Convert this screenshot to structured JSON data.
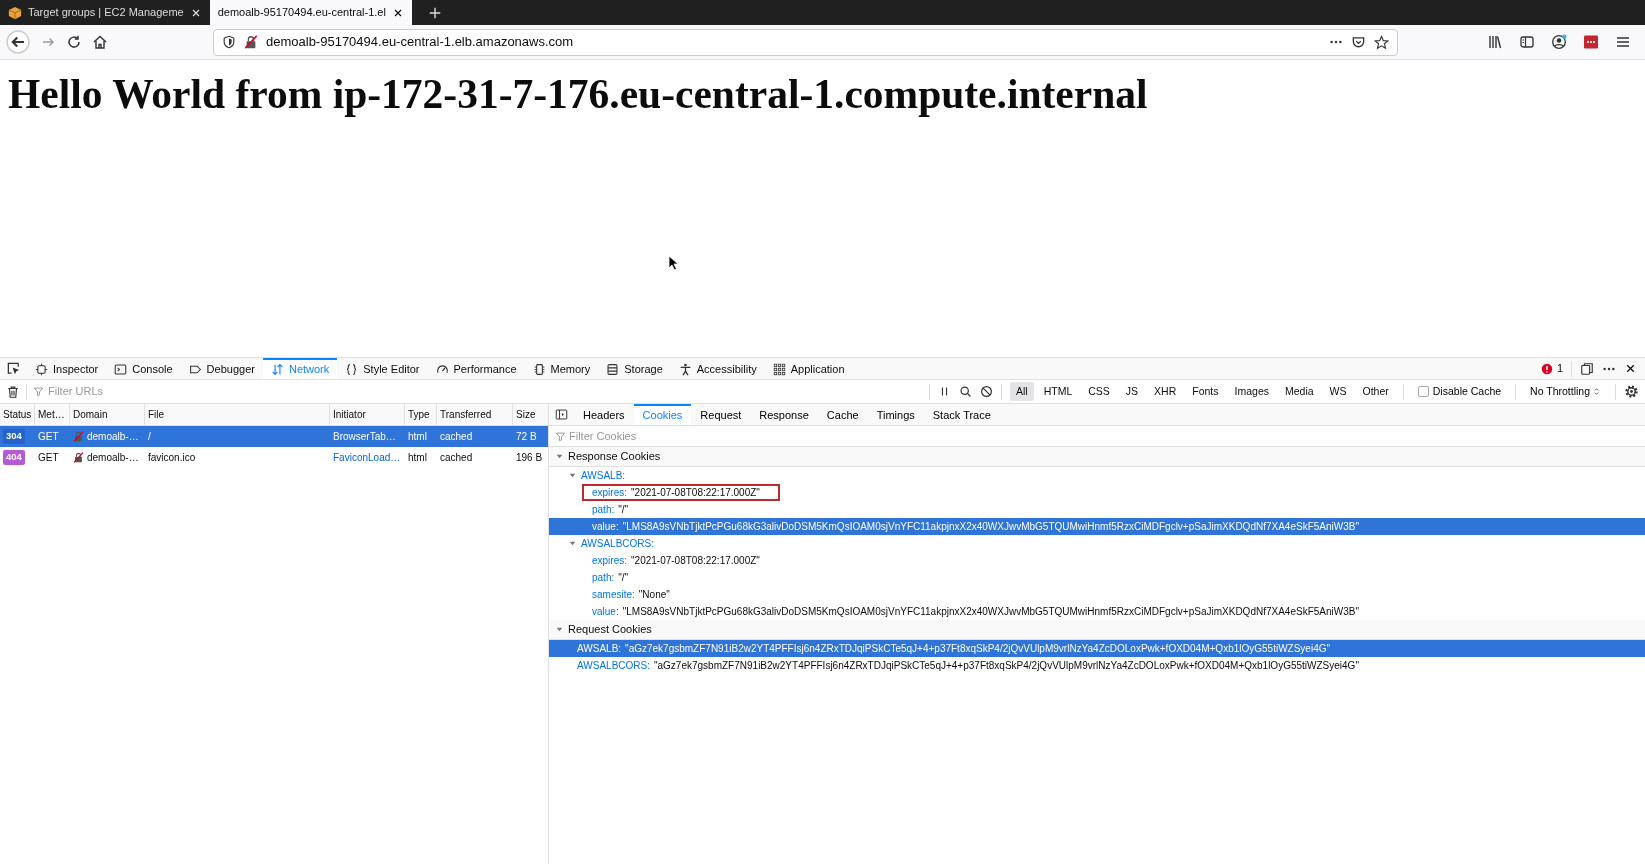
{
  "browser_tabs": [
    {
      "title": "Target groups | EC2 Manageme",
      "selected": false
    },
    {
      "title": "demoalb-95170494.eu-central-1.el",
      "selected": true
    }
  ],
  "address_bar": {
    "url": "demoalb-95170494.eu-central-1.elb.amazonaws.com"
  },
  "page": {
    "heading": "Hello World from ip-172-31-7-176.eu-central-1.compute.internal"
  },
  "devtools": {
    "tools": [
      {
        "label": "Inspector",
        "selected": false
      },
      {
        "label": "Console",
        "selected": false
      },
      {
        "label": "Debugger",
        "selected": false
      },
      {
        "label": "Network",
        "selected": true
      },
      {
        "label": "Style Editor",
        "selected": false
      },
      {
        "label": "Performance",
        "selected": false
      },
      {
        "label": "Memory",
        "selected": false
      },
      {
        "label": "Storage",
        "selected": false
      },
      {
        "label": "Accessibility",
        "selected": false
      },
      {
        "label": "Application",
        "selected": false
      }
    ],
    "error_count": "1",
    "filter_placeholder": "Filter URLs",
    "type_filters": [
      {
        "label": "All",
        "selected": true
      },
      {
        "label": "HTML",
        "selected": false
      },
      {
        "label": "CSS",
        "selected": false
      },
      {
        "label": "JS",
        "selected": false
      },
      {
        "label": "XHR",
        "selected": false
      },
      {
        "label": "Fonts",
        "selected": false
      },
      {
        "label": "Images",
        "selected": false
      },
      {
        "label": "Media",
        "selected": false
      },
      {
        "label": "WS",
        "selected": false
      },
      {
        "label": "Other",
        "selected": false
      }
    ],
    "disable_cache": {
      "label": "Disable Cache",
      "checked": false
    },
    "throttling": "No Throttling",
    "columns": [
      "Status",
      "Met…",
      "Domain",
      "File",
      "Initiator",
      "Type",
      "Transferred",
      "Size"
    ],
    "requests": [
      {
        "status": "304",
        "color": "#2563c9",
        "method": "GET",
        "domain": "demoalb-…",
        "file": "/",
        "initiator": "BrowserTab…",
        "type": "html",
        "transferred": "cached",
        "size": "72 B",
        "selected": true
      },
      {
        "status": "404",
        "color": "#b65ad6",
        "method": "GET",
        "domain": "demoalb-…",
        "file": "favicon.ico",
        "initiator": "FaviconLoad…",
        "type": "html",
        "transferred": "cached",
        "size": "196 B",
        "selected": false
      }
    ],
    "detail_tabs": [
      {
        "label": "Headers",
        "selected": false
      },
      {
        "label": "Cookies",
        "selected": true
      },
      {
        "label": "Request",
        "selected": false
      },
      {
        "label": "Response",
        "selected": false
      },
      {
        "label": "Cache",
        "selected": false
      },
      {
        "label": "Timings",
        "selected": false
      },
      {
        "label": "Stack Trace",
        "selected": false
      }
    ],
    "cookie_filter_placeholder": "Filter Cookies",
    "cookie_sections": [
      {
        "title": "Response Cookies",
        "expanded": true,
        "children": [
          {
            "kind": "group",
            "name": "AWSALB:",
            "expanded": true,
            "children": [
              {
                "kind": "property",
                "key": "expires:",
                "value": "\"2021-07-08T08:22:17.000Z\"",
                "selected": false,
                "outlined": true
              },
              {
                "kind": "property",
                "key": "path:",
                "value": "\"/\"",
                "selected": false,
                "outlined": false
              },
              {
                "kind": "property",
                "key": "value:",
                "value": "\"LMS8A9sVNbTjktPcPGu68kG3alivDoDSM5KmQsIOAM0sjVnYFC11akpjnxX2x40WXJwvMbG5TQUMwiHnmf5RzxCiMDFgclv+pSaJimXKDQdNf7XA4eSkF5AniW3B\"",
                "selected": true,
                "outlined": false
              }
            ]
          },
          {
            "kind": "group",
            "name": "AWSALBCORS:",
            "expanded": true,
            "children": [
              {
                "kind": "property",
                "key": "expires:",
                "value": "\"2021-07-08T08:22:17.000Z\"",
                "selected": false,
                "outlined": false
              },
              {
                "kind": "property",
                "key": "path:",
                "value": "\"/\"",
                "selected": false,
                "outlined": false
              },
              {
                "kind": "property",
                "key": "samesite:",
                "value": "\"None\"",
                "selected": false,
                "outlined": false
              },
              {
                "kind": "property",
                "key": "value:",
                "value": "\"LMS8A9sVNbTjktPcPGu68kG3alivDoDSM5KmQsIOAM0sjVnYFC11akpjnxX2x40WXJwvMbG5TQUMwiHnmf5RzxCiMDFgclv+pSaJimXKDQdNf7XA4eSkF5AniW3B\"",
                "selected": false,
                "outlined": false
              }
            ]
          }
        ]
      },
      {
        "title": "Request Cookies",
        "expanded": true,
        "children": [
          {
            "kind": "property",
            "key": "AWSALB:",
            "value": "\"aGz7ek7gsbmZF7N91iB2w2YT4PFFIsj6n4ZRxTDJqiPSkCTe5qJ+4+p37Ft8xqSkP4/2jQvVUlpM9vrlNzYa4ZcDOLoxPwk+fOXD04M+Qxb1lOyG55tiWZSyei4G\"",
            "selected": true,
            "outlined": false
          },
          {
            "kind": "property",
            "key": "AWSALBCORS:",
            "value": "\"aGz7ek7gsbmZF7N91iB2w2YT4PFFIsj6n4ZRxTDJqiPSkCTe5qJ+4+p37Ft8xqSkP4/2jQvVUlpM9vrlNzYa4ZcDOLoxPwk+fOXD04M+Qxb1lOyG55tiWZSyei4G\"",
            "selected": false,
            "outlined": false
          }
        ]
      }
    ]
  }
}
